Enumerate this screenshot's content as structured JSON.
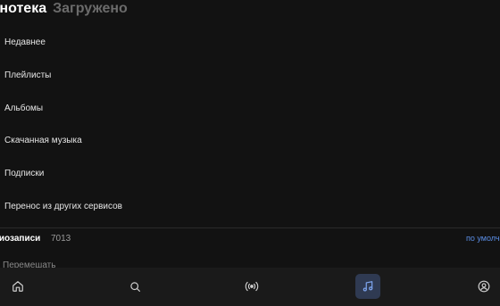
{
  "header": {
    "active_tab": "Фонотека",
    "inactive_tab": "Загружено"
  },
  "menu": {
    "items": [
      {
        "label": "Недавнее"
      },
      {
        "label": "Плейлисты"
      },
      {
        "label": "Альбомы"
      },
      {
        "label": "Скачанная музыка"
      },
      {
        "label": "Подписки"
      },
      {
        "label": "Перенос из других сервисов"
      }
    ]
  },
  "section": {
    "title": "Аудиозаписи",
    "count": "7013",
    "sort_label": "по умолчанию"
  },
  "partial_row": {
    "text": "Перемешать"
  },
  "bottom_nav": {
    "items": [
      {
        "icon": "home-icon"
      },
      {
        "icon": "search-icon"
      },
      {
        "icon": "radio-icon"
      },
      {
        "icon": "music-note-icon",
        "active": true
      },
      {
        "icon": "profile-icon"
      }
    ],
    "active_color": "#5b8ee6"
  },
  "colors": {
    "background": "#121212",
    "accent": "#5b8ee6",
    "muted": "#6b6b6b"
  }
}
